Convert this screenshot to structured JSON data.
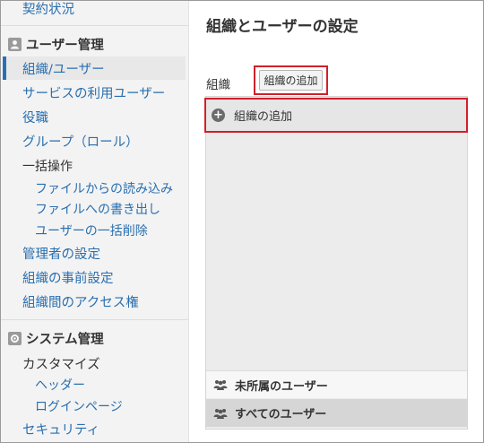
{
  "sidebar": {
    "contract_status": "契約状況",
    "user_admin_header": "ユーザー管理",
    "items": [
      {
        "label": "組織/ユーザー"
      },
      {
        "label": "サービスの利用ユーザー"
      },
      {
        "label": "役職"
      },
      {
        "label": "グループ（ロール）"
      }
    ],
    "bulk_ops_label": "一括操作",
    "bulk_sub": [
      {
        "label": "ファイルからの読み込み"
      },
      {
        "label": "ファイルへの書き出し"
      },
      {
        "label": "ユーザーの一括削除"
      }
    ],
    "items2": [
      {
        "label": "管理者の設定"
      },
      {
        "label": "組織の事前設定"
      },
      {
        "label": "組織間のアクセス権"
      }
    ],
    "system_admin_header": "システム管理",
    "customize_label": "カスタマイズ",
    "customize_sub": [
      {
        "label": "ヘッダー"
      },
      {
        "label": "ログインページ"
      }
    ],
    "security_label": "セキュリティ"
  },
  "main": {
    "title": "組織とユーザーの設定",
    "org_label": "組織",
    "add_org_button": "組織の追加",
    "add_org_row": "組織の追加",
    "unassigned_users": "未所属のユーザー",
    "all_users": "すべてのユーザー"
  },
  "colors": {
    "link": "#2a6fb0",
    "highlight": "#d0202a"
  }
}
